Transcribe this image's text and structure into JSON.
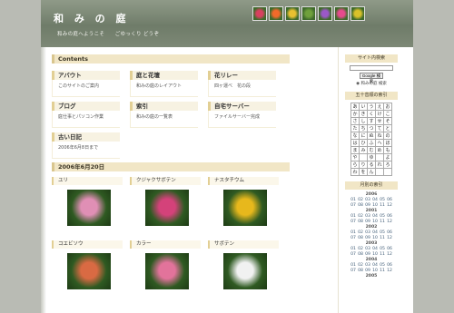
{
  "header": {
    "title": "和 み の 庭",
    "subtitle": "和みの庭へようこそ　　ごゆっくり どうぞ",
    "thumb_colors": [
      "#d8405f",
      "#f06a2a",
      "#e9c130",
      "#6fa03c",
      "#9b58c8",
      "#e84a8d",
      "#d9c12a"
    ]
  },
  "contents": {
    "heading": "Contents",
    "items": [
      {
        "title": "アバウト",
        "desc": "このサイトのご案内"
      },
      {
        "title": "庭と花壇",
        "desc": "和みの庭のレイアウト"
      },
      {
        "title": "花リレー",
        "desc": "四ヶ運べ　花の段"
      },
      {
        "title": "ブログ",
        "desc": "庭仕事とパソコン作業"
      },
      {
        "title": "索引",
        "desc": "和みの庭の一覧表"
      },
      {
        "title": "自宅サーバー",
        "desc": "ファイルサーバー完成"
      },
      {
        "title": "古い日記",
        "desc": "2006年6月8日まで"
      }
    ]
  },
  "diary": {
    "date_heading": "2006年6月20日",
    "photos": [
      {
        "name": "ユリ",
        "color": "#e08fb5"
      },
      {
        "name": "クジャクサボテン",
        "color": "#d4427a"
      },
      {
        "name": "ナスタチウム",
        "color": "#e7b81c"
      },
      {
        "name": "コエビソウ",
        "color": "#d96a43"
      },
      {
        "name": "カラー",
        "color": "#e2739b"
      },
      {
        "name": "サボテン",
        "color": "#f1f1f1"
      }
    ]
  },
  "sidebar": {
    "search_heading": "サイト内検索",
    "search_button": "Google 検索",
    "search_radio": "和みの庭 検索",
    "index_heading": "五十音順の索引",
    "kana_rows": [
      [
        "あ",
        "い",
        "う",
        "え",
        "お"
      ],
      [
        "か",
        "き",
        "く",
        "け",
        "こ"
      ],
      [
        "さ",
        "し",
        "す",
        "せ",
        "そ"
      ],
      [
        "た",
        "ち",
        "つ",
        "て",
        "と"
      ],
      [
        "な",
        "に",
        "ぬ",
        "ね",
        "の"
      ],
      [
        "は",
        "ひ",
        "ふ",
        "へ",
        "ほ"
      ],
      [
        "ま",
        "み",
        "む",
        "め",
        "も"
      ],
      [
        "や",
        "",
        "ゆ",
        "",
        "よ"
      ],
      [
        "ら",
        "り",
        "る",
        "れ",
        "ろ"
      ],
      [
        "わ",
        "を",
        "ん",
        "",
        ""
      ]
    ],
    "monthly_heading": "月別の索引",
    "years": [
      {
        "year": "2006",
        "months": [
          "01",
          "02",
          "03",
          "04",
          "05",
          "06",
          "07",
          "08",
          "09",
          "10",
          "11",
          "12"
        ]
      },
      {
        "year": "2001",
        "months": [
          "01",
          "02",
          "03",
          "04",
          "05",
          "06",
          "07",
          "08",
          "09",
          "10",
          "11",
          "12"
        ]
      },
      {
        "year": "2002",
        "months": [
          "01",
          "02",
          "03",
          "04",
          "05",
          "06",
          "07",
          "08",
          "09",
          "10",
          "11",
          "12"
        ]
      },
      {
        "year": "2003",
        "months": [
          "01",
          "02",
          "03",
          "04",
          "05",
          "06",
          "07",
          "08",
          "09",
          "10",
          "11",
          "12"
        ]
      },
      {
        "year": "2004",
        "months": [
          "01",
          "02",
          "03",
          "04",
          "05",
          "06",
          "07",
          "08",
          "09",
          "10",
          "11",
          "12"
        ]
      },
      {
        "year": "2005",
        "months": []
      }
    ]
  }
}
